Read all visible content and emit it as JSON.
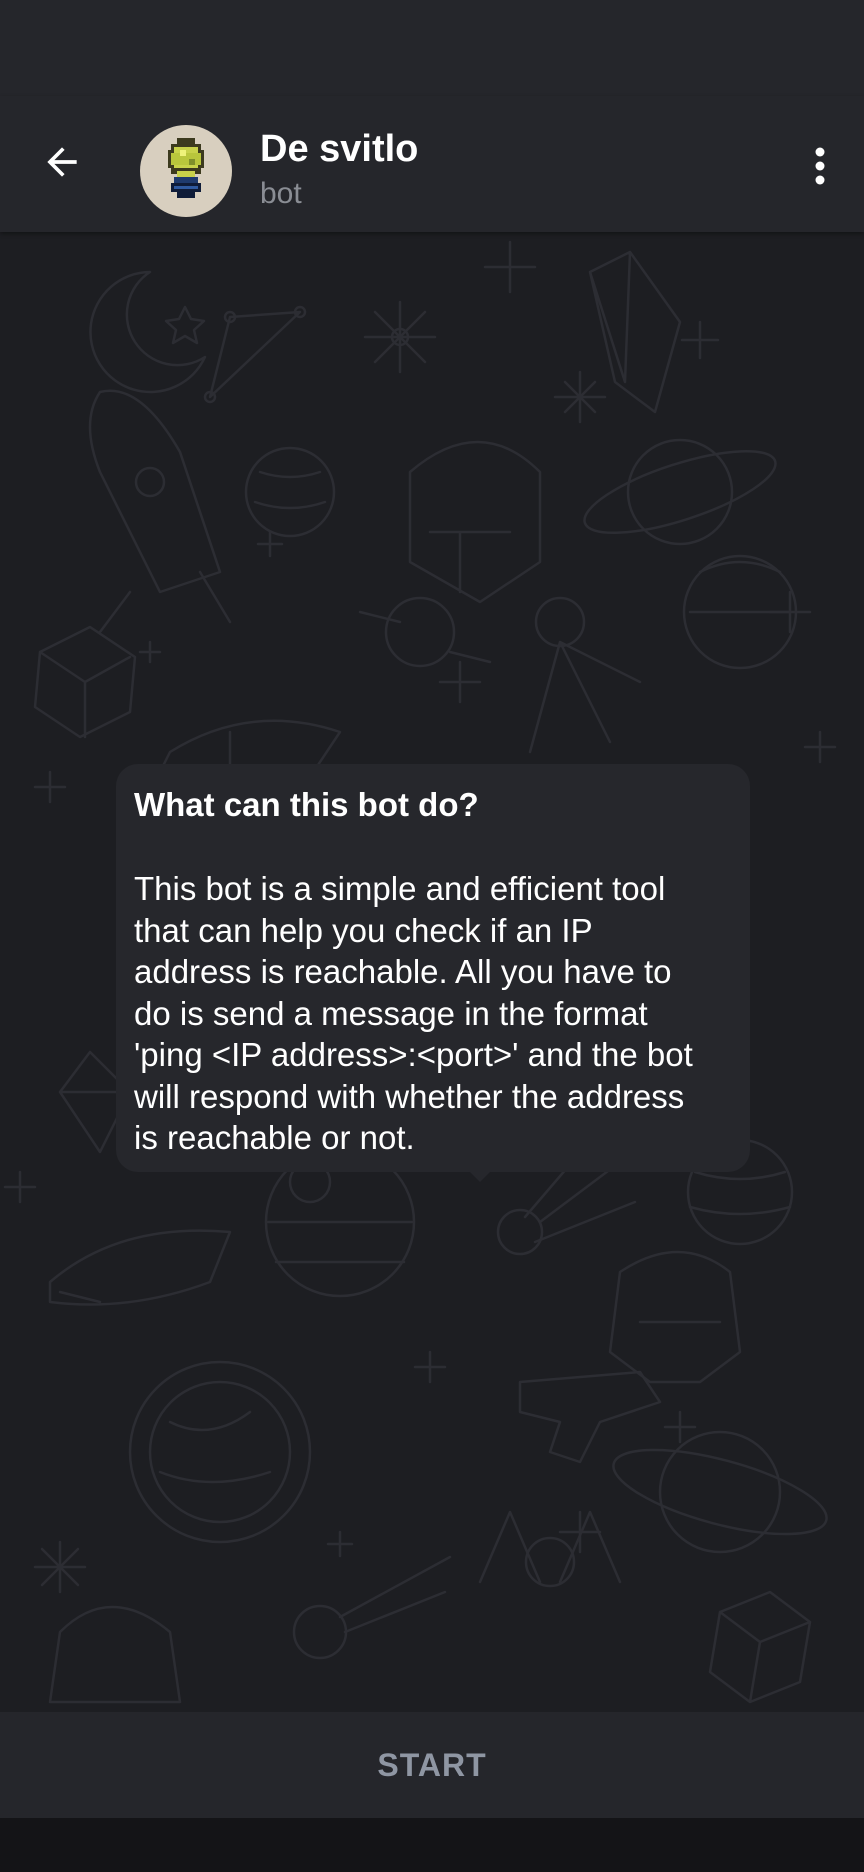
{
  "header": {
    "title": "De svitlo",
    "subtitle": "bot",
    "back_icon": "arrow-left-icon",
    "menu_icon": "more-vertical-icon",
    "avatar_icon": "lightbulb-avatar"
  },
  "bot_info": {
    "title": "What can this bot do?",
    "description": "This bot is a simple and efficient tool\nthat can help you check if an IP\naddress is reachable. All you have to\ndo is send a message in the format\n'ping <IP address>:<port>' and the bot\nwill respond with whether the address\nis reachable or not."
  },
  "bottom": {
    "start_label": "START"
  },
  "colors": {
    "background": "#1d1e22",
    "header": "#25262b",
    "bubble": "#26272c",
    "muted_text": "#8a8d94",
    "start_text": "#8f96a3"
  }
}
